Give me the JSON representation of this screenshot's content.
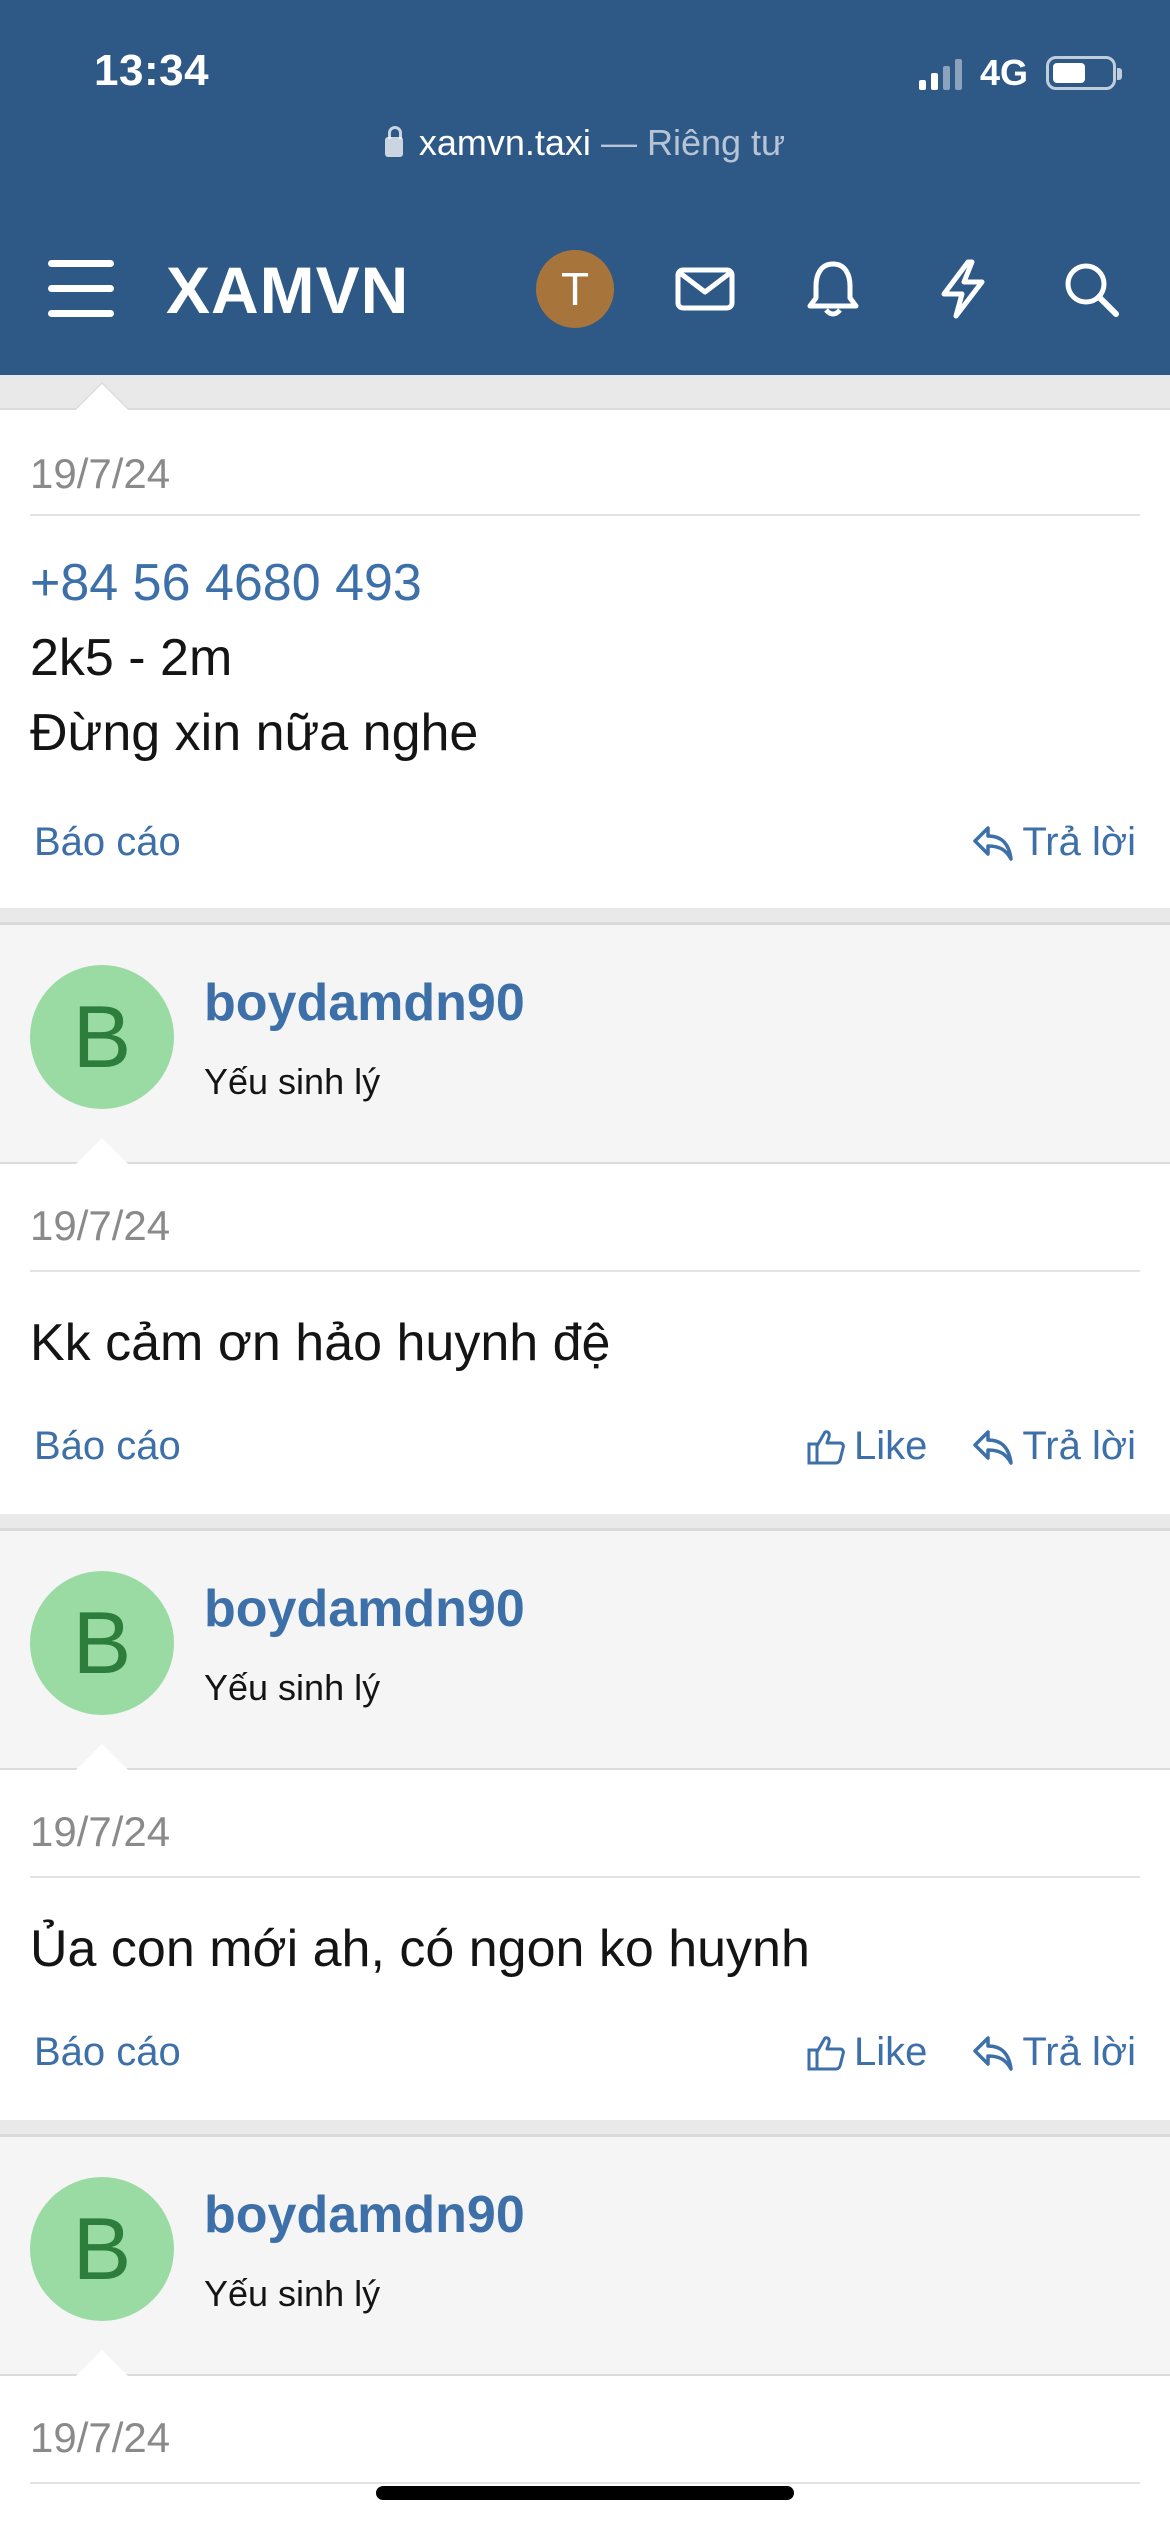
{
  "status_bar": {
    "time": "13:34",
    "network": "4G"
  },
  "browser": {
    "host": "xamvn.taxi",
    "separator": " — ",
    "privacy": "Riêng tư"
  },
  "navbar": {
    "brand": "XAMVN",
    "avatar_letter": "T"
  },
  "posts": [
    {
      "date": "19/7/24",
      "phone": "+84 56 4680 493",
      "lines": [
        "2k5 - 2m",
        "Đừng xin nữa nghe"
      ],
      "report": "Báo cáo",
      "reply": "Trả lời"
    },
    {
      "avatar_letter": "B",
      "username": "boydamdn90",
      "user_title": "Yếu sinh lý",
      "date": "19/7/24",
      "text": "Kk cảm ơn hảo huynh đệ",
      "report": "Báo cáo",
      "like": "Like",
      "reply": "Trả lời"
    },
    {
      "avatar_letter": "B",
      "username": "boydamdn90",
      "user_title": "Yếu sinh lý",
      "date": "19/7/24",
      "text": "Ủa con mới ah, có ngon ko huynh",
      "report": "Báo cáo",
      "like": "Like",
      "reply": "Trả lời"
    },
    {
      "avatar_letter": "B",
      "username": "boydamdn90",
      "user_title": "Yếu sinh lý",
      "date": "19/7/24"
    }
  ],
  "icons": [
    "menu-icon",
    "mail-icon",
    "bell-icon",
    "bolt-icon",
    "search-icon",
    "like-icon",
    "reply-icon",
    "lock-icon"
  ]
}
